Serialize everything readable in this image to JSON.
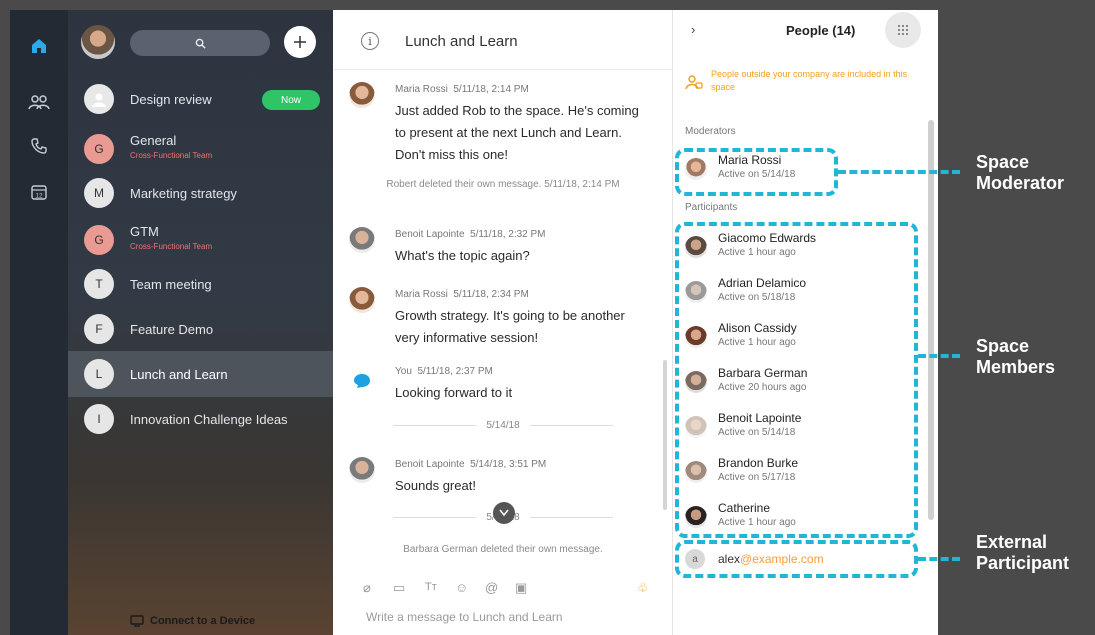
{
  "colors": {
    "rail": "#242a33",
    "accent_blue": "#21b6d6",
    "now_green": "#2fc566",
    "external_orange": "#f2a03a",
    "highlight": "#4e545c"
  },
  "icons": {
    "rail": [
      "home-icon",
      "people-icon",
      "phone-icon",
      "calendar-icon"
    ],
    "calendar_day": "12"
  },
  "spaces": {
    "items": [
      {
        "initial": "",
        "name": "Design review",
        "subtitle": "",
        "badge": "Now",
        "active": false
      },
      {
        "initial": "G",
        "name": "General",
        "subtitle": "Cross-Functional Team",
        "badge": "",
        "active": false
      },
      {
        "initial": "M",
        "name": "Marketing strategy",
        "subtitle": "",
        "badge": "",
        "active": false
      },
      {
        "initial": "G",
        "name": "GTM",
        "subtitle": "Cross-Functional Team",
        "badge": "",
        "active": false
      },
      {
        "initial": "T",
        "name": "Team meeting",
        "subtitle": "",
        "badge": "",
        "active": false
      },
      {
        "initial": "F",
        "name": "Feature Demo",
        "subtitle": "",
        "badge": "",
        "active": false
      },
      {
        "initial": "L",
        "name": "Lunch and Learn",
        "subtitle": "",
        "badge": "",
        "active": true
      },
      {
        "initial": "I",
        "name": "Innovation Challenge Ideas",
        "subtitle": "",
        "badge": "",
        "active": false
      }
    ],
    "connect_label": "Connect to a Device"
  },
  "chat": {
    "title": "Lunch and Learn",
    "messages": [
      {
        "sender": "Maria Rossi",
        "time": "5/11/18, 2:14 PM",
        "text": "Just added Rob to the space. He's coming to present at the next Lunch and Learn. Don't miss this one!"
      },
      {
        "sender": "Benoit Lapointe",
        "time": "5/11/18, 2:32 PM",
        "text": "What's the topic again?"
      },
      {
        "sender": "Maria Rossi",
        "time": "5/11/18, 2:34 PM",
        "text": "Growth strategy. It's going to be another very informative session!"
      },
      {
        "sender": "You",
        "time": "5/11/18, 2:37 PM",
        "text": "Looking forward to it"
      },
      {
        "sender": "Benoit Lapointe",
        "time": "5/14/18, 3:51 PM",
        "text": "Sounds great!"
      }
    ],
    "system_notes": [
      "Robert deleted their own message. 5/11/18, 2:14 PM",
      "Barbara German deleted their own message."
    ],
    "date_dividers": [
      "5/14/18",
      "5/14/18"
    ],
    "composer_placeholder": "Write a message to Lunch and Learn",
    "composer_icons": [
      "attach-icon",
      "whiteboard-icon",
      "text-format-icon",
      "emoji-icon",
      "mention-icon",
      "gif-icon"
    ]
  },
  "people": {
    "title": "People (14)",
    "external_warning": "People outside your company are included in this space",
    "moderators_label": "Moderators",
    "participants_label": "Participants",
    "moderators": [
      {
        "name": "Maria Rossi",
        "status": "Active on 5/14/18"
      }
    ],
    "participants": [
      {
        "name": "Giacomo Edwards",
        "status": "Active 1 hour ago"
      },
      {
        "name": "Adrian Delamico",
        "status": "Active on 5/18/18"
      },
      {
        "name": "Alison Cassidy",
        "status": "Active 1 hour ago"
      },
      {
        "name": "Barbara German",
        "status": "Active 20 hours ago"
      },
      {
        "name": "Benoit Lapointe",
        "status": "Active on 5/14/18"
      },
      {
        "name": "Brandon Burke",
        "status": "Active on 5/17/18"
      },
      {
        "name": "Catherine",
        "status": "Active 1 hour ago"
      }
    ],
    "external": {
      "initial": "a",
      "user": "alex",
      "domain": "@example.com"
    }
  },
  "annotations": {
    "space_moderator": [
      "Space",
      "Moderator"
    ],
    "space_members": [
      "Space",
      "Members"
    ],
    "external_participant": [
      "External",
      "Participant"
    ]
  }
}
